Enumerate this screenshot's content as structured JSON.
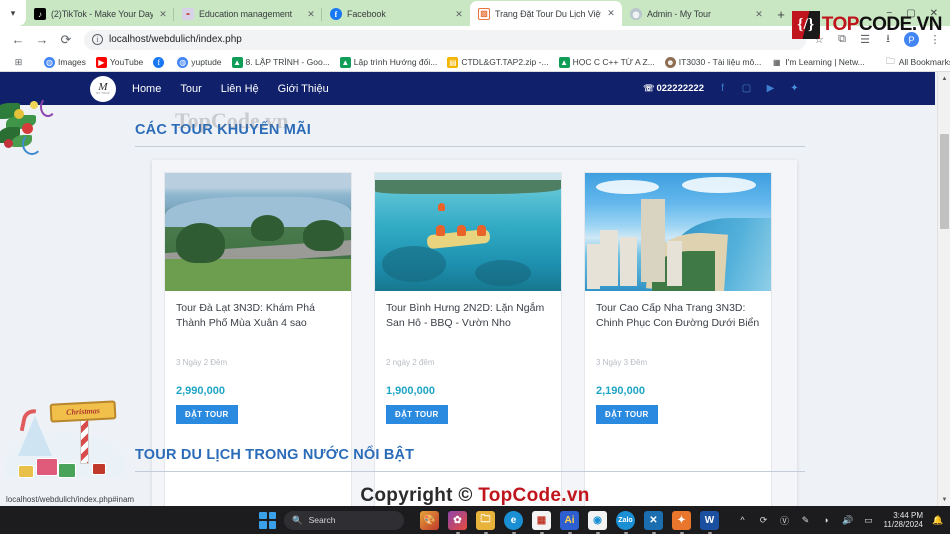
{
  "browser": {
    "tabs": [
      {
        "title": "(2)TikTok - Make Your Day",
        "favicon": "tiktok-icon",
        "active": false
      },
      {
        "title": "Education management",
        "favicon": "education-icon",
        "active": false
      },
      {
        "title": "Facebook",
        "favicon": "facebook-icon",
        "active": false
      },
      {
        "title": "Trang Đặt Tour Du Lịch Việt Na",
        "favicon": "tour-icon",
        "active": true
      },
      {
        "title": "Admin - My Tour",
        "favicon": "admin-icon",
        "active": false
      }
    ],
    "new_tab_label": "+",
    "close_label": "✕",
    "window_controls": {
      "minimize": "−",
      "maximize": "▢",
      "close": "✕"
    },
    "nav": {
      "back": "←",
      "forward": "→",
      "reload": "⟳"
    },
    "url": "localhost/webdulich/index.php",
    "omni_icons": [
      "star-icon",
      "split-screen-icon",
      "reading-list-icon",
      "download-icon",
      "profile-avatar",
      "menu-icon"
    ],
    "profile_initial": "P",
    "bookmarks": [
      {
        "label": "Images",
        "icon": "globe-icon"
      },
      {
        "label": "YouTube",
        "icon": "youtube-icon"
      },
      {
        "label": "",
        "icon": "facebook-icon"
      },
      {
        "label": "yuptude",
        "icon": "globe-icon"
      },
      {
        "label": "8. LẬP TRÌNH - Goo...",
        "icon": "drive-icon"
      },
      {
        "label": "Lập trình Hướng đối...",
        "icon": "drive-icon"
      },
      {
        "label": "CTDL&GT.TAP2.zip -...",
        "icon": "file-icon"
      },
      {
        "label": "HỌC C C++ TỪ A Z...",
        "icon": "drive-icon"
      },
      {
        "label": "IT3030 - Tài liệu mô...",
        "icon": "person-icon"
      },
      {
        "label": "I'm Learning | Netw...",
        "icon": "network-icon"
      }
    ],
    "all_bookmarks_label": "All Bookmarks",
    "all_bookmarks_icon": "folder-icon",
    "status_bubble": "localhost/webdulich/index.php#inam"
  },
  "watermark": {
    "logo_left": "TOP",
    "logo_right": "CODE.VN",
    "badge_glyph": "{/}",
    "copyright_text": "Copyright © ",
    "copyright_brand": "TopCode.vn",
    "ghost_text": "TopCode.vn"
  },
  "site": {
    "brand": {
      "mark": "M",
      "sub": "MY TOUR"
    },
    "nav_items": [
      "Home",
      "Tour",
      "Liên Hệ",
      "Giới Thiệu"
    ],
    "phone": "022222222",
    "phone_icon": "phone-icon",
    "social": [
      {
        "name": "facebook-icon",
        "glyph": "f"
      },
      {
        "name": "instagram-icon",
        "glyph": "◻"
      },
      {
        "name": "youtube-icon",
        "glyph": "▶"
      },
      {
        "name": "twitter-icon",
        "glyph": "🐦"
      }
    ],
    "sections": [
      {
        "heading": "CÁC TOUR KHUYẾN MÃI"
      },
      {
        "heading": "TOUR DU LỊCH TRONG NƯỚC NỔI BẬT"
      }
    ],
    "tours": [
      {
        "title": "Tour Đà Lạt 3N3D: Khám Phá Thành Phố Mùa Xuân 4 sao",
        "duration": "3 Ngày 2 Đêm",
        "price": "2,990,000",
        "button": "ĐẶT TOUR",
        "image_alt": "da-lat-lake-aerial"
      },
      {
        "title": "Tour Bình Hưng 2N2D: Lặn Ngắm San Hô - BBQ - Vườn Nho",
        "duration": "2 ngày 2 đêm",
        "price": "1,900,000",
        "button": "ĐẶT TOUR",
        "image_alt": "binh-hung-snorkeling"
      },
      {
        "title": "Tour Cao Cấp Nha Trang 3N3D: Chinh Phục Con Đường Dưới Biển",
        "duration": "3 Ngày 3 Đêm",
        "price": "2,190,000",
        "button": "ĐẶT TOUR",
        "image_alt": "nha-trang-coastline"
      }
    ],
    "xmas_sign": "Christmas",
    "colors": {
      "navbar": "#10206b",
      "heading": "#2b6cb8",
      "price": "#1fa5c4",
      "button": "#2a8ae0"
    }
  },
  "taskbar": {
    "start_label": "start-button",
    "search_placeholder": "Search",
    "search_icon": "search-icon",
    "apps": [
      {
        "name": "paint-3d-app",
        "glyph": "🎨"
      },
      {
        "name": "photos-app",
        "glyph": "🌸"
      },
      {
        "name": "file-explorer-app",
        "glyph": "📁"
      },
      {
        "name": "edge-app",
        "glyph": "e"
      },
      {
        "name": "store-app",
        "glyph": "🛍"
      },
      {
        "name": "illustrator-app",
        "glyph": "Ai"
      },
      {
        "name": "chrome-app",
        "glyph": "◉"
      },
      {
        "name": "zalo-app",
        "glyph": "Z"
      },
      {
        "name": "vscode-app",
        "glyph": "✕"
      },
      {
        "name": "xampp-app",
        "glyph": "✦"
      },
      {
        "name": "word-app",
        "glyph": "W"
      }
    ],
    "tray": [
      "chevron-up-icon",
      "update-icon",
      "vpn-icon",
      "pen-icon",
      "wifi-icon",
      "volume-icon",
      "battery-icon"
    ],
    "time": "3:44 PM",
    "date": "11/28/2024",
    "notification_icon": "bell-icon"
  }
}
